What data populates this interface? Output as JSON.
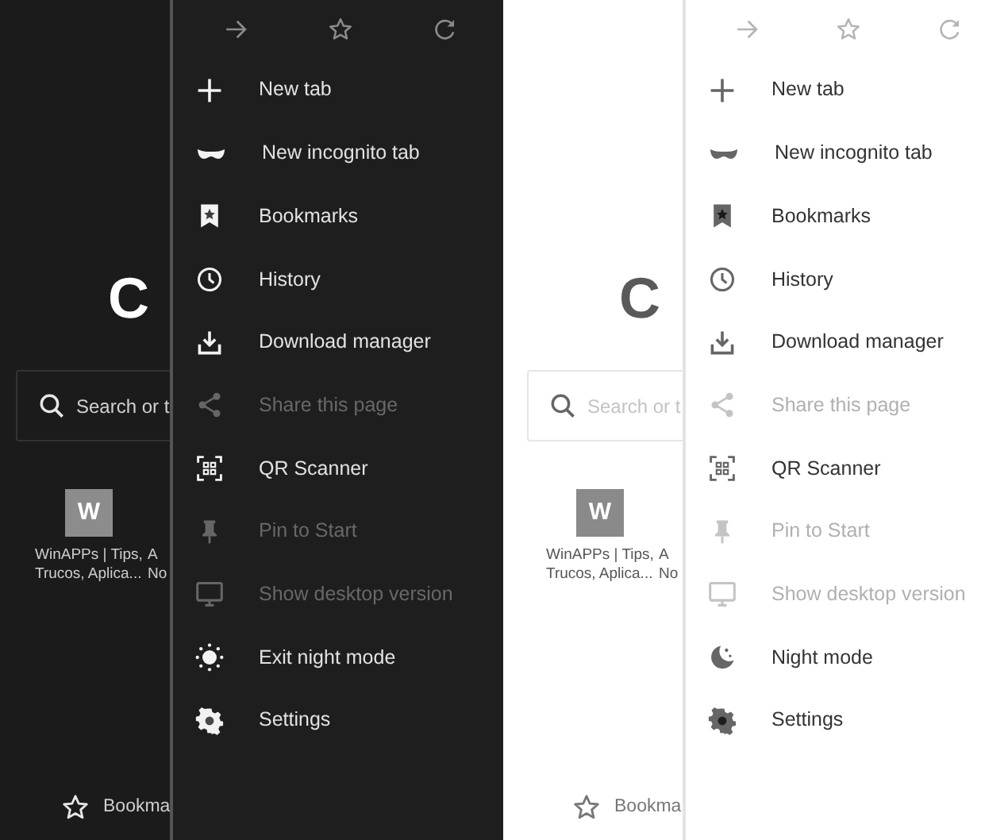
{
  "panels": [
    {
      "kind": "dark",
      "page": {
        "logo": "C",
        "search_placeholder": "Search or t",
        "tiles": [
          {
            "letter": "W",
            "lines": [
              "WinAPPs | Tips,",
              "Trucos, Aplica..."
            ]
          },
          {
            "lines": [
              "A",
              "No"
            ]
          }
        ],
        "bottom_bar": {
          "label": "Bookma"
        }
      },
      "menu": {
        "toolbar": [
          {
            "kind": "forward"
          },
          {
            "kind": "star"
          },
          {
            "kind": "refresh"
          }
        ],
        "items": [
          {
            "kind": "plus",
            "label": "New tab",
            "disabled": false
          },
          {
            "kind": "mask",
            "label": "New incognito tab",
            "disabled": false
          },
          {
            "kind": "bookmark",
            "label": "Bookmarks",
            "disabled": false
          },
          {
            "kind": "clock",
            "label": "History",
            "disabled": false
          },
          {
            "kind": "download",
            "label": "Download manager",
            "disabled": false
          },
          {
            "kind": "share",
            "label": "Share this page",
            "disabled": true
          },
          {
            "kind": "qr",
            "label": "QR Scanner",
            "disabled": false
          },
          {
            "kind": "pin",
            "label": "Pin to Start",
            "disabled": true
          },
          {
            "kind": "monitor",
            "label": "Show desktop version",
            "disabled": true
          },
          {
            "kind": "sun",
            "label": "Exit night mode",
            "disabled": false
          },
          {
            "kind": "gear",
            "label": "Settings",
            "disabled": false
          }
        ]
      }
    },
    {
      "kind": "light",
      "page": {
        "logo": "C",
        "search_placeholder": "Search or t",
        "tiles": [
          {
            "letter": "W",
            "lines": [
              "WinAPPs | Tips,",
              "Trucos, Aplica..."
            ]
          },
          {
            "lines": [
              "A",
              "No"
            ]
          }
        ],
        "bottom_bar": {
          "label": "Bookma"
        }
      },
      "menu": {
        "toolbar": [
          {
            "kind": "forward"
          },
          {
            "kind": "star"
          },
          {
            "kind": "refresh"
          }
        ],
        "items": [
          {
            "kind": "plus",
            "label": "New tab",
            "disabled": false
          },
          {
            "kind": "mask",
            "label": "New incognito tab",
            "disabled": false
          },
          {
            "kind": "bookmark",
            "label": "Bookmarks",
            "disabled": false
          },
          {
            "kind": "clock",
            "label": "History",
            "disabled": false
          },
          {
            "kind": "download",
            "label": "Download manager",
            "disabled": false
          },
          {
            "kind": "share",
            "label": "Share this page",
            "disabled": true
          },
          {
            "kind": "qr",
            "label": "QR Scanner",
            "disabled": false
          },
          {
            "kind": "pin",
            "label": "Pin to Start",
            "disabled": true
          },
          {
            "kind": "monitor",
            "label": "Show desktop version",
            "disabled": true
          },
          {
            "kind": "moon",
            "label": "Night mode",
            "disabled": false
          },
          {
            "kind": "gear",
            "label": "Settings",
            "disabled": false
          }
        ]
      }
    }
  ]
}
